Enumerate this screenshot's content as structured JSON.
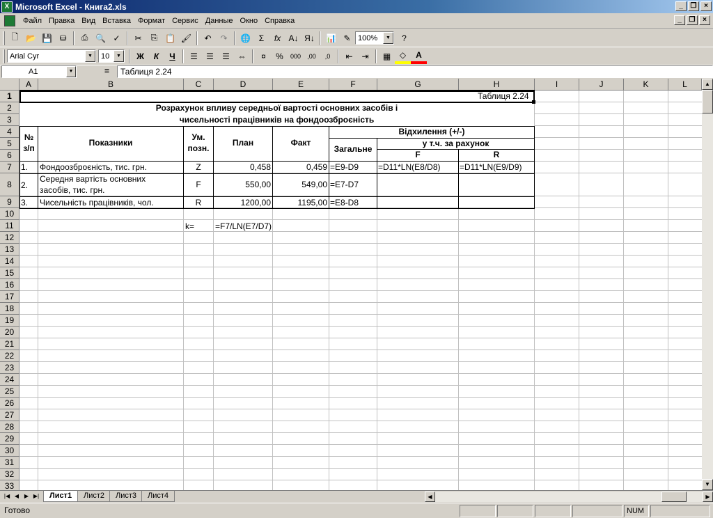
{
  "window": {
    "title": "Microsoft Excel - Книга2.xls",
    "app_icon_glyph": "X"
  },
  "menu": [
    "Файл",
    "Правка",
    "Вид",
    "Вставка",
    "Формат",
    "Сервис",
    "Данные",
    "Окно",
    "Справка"
  ],
  "toolbar": {
    "zoom": "100%",
    "font": "Arial Cyr",
    "font_size": "10",
    "bold_glyph": "Ж",
    "italic_glyph": "К",
    "underline_glyph": "Ч",
    "percent_glyph": "%",
    "thousands_glyph": "000",
    "inc_dec_glyph": ",00",
    "dec_dec_glyph": ",0",
    "sum_glyph": "Σ",
    "fx_glyph": "fx",
    "accent_fill": "#ffff00",
    "accent_font": "#ff0000"
  },
  "formula_bar": {
    "name_box": "A1",
    "eq": "=",
    "content": "Таблиця 2.24"
  },
  "columns": [
    "A",
    "B",
    "C",
    "D",
    "E",
    "F",
    "G",
    "H",
    "I",
    "J",
    "K",
    "L"
  ],
  "rows": [
    "1",
    "2",
    "3",
    "4",
    "5",
    "6",
    "7",
    "8",
    "9",
    "10",
    "11",
    "12",
    "13",
    "14",
    "15",
    "16",
    "17",
    "18",
    "19",
    "20",
    "21",
    "22",
    "23",
    "24",
    "25",
    "26",
    "27",
    "28",
    "29",
    "30",
    "31",
    "32",
    "33"
  ],
  "sheet": {
    "h1": "Таблиця 2.24",
    "title1": "Розрахунок впливу середньої вартості основних засобів і",
    "title2": "чисельності працівників на фондоозброєність",
    "hdr_num1": "№",
    "hdr_num2": "з/п",
    "hdr_indicators": "Показники",
    "hdr_sym1": "Ум.",
    "hdr_sym2": "позн.",
    "hdr_plan": "План",
    "hdr_fact": "Факт",
    "hdr_dev": "Відхилення (+/-)",
    "hdr_total": "Загальне",
    "hdr_incl": "у т.ч. за рахунок",
    "hdr_F": "F",
    "hdr_R": "R",
    "r7": [
      "1.",
      "Фондоозброєність, тис. грн.",
      "Z",
      "0,458",
      "0,459",
      "=E9-D9",
      "=D11*LN(E8/D8)",
      "=D11*LN(E9/D9)"
    ],
    "r8": [
      "2.",
      "Середня вартість основних",
      "засобів, тис. грн.",
      "F",
      "550,00",
      "549,00",
      "=E7-D7"
    ],
    "r9": [
      "3.",
      "Чисельність працівників, чол.",
      "R",
      "1200,00",
      "1195,00",
      "=E8-D8"
    ],
    "k_label": "k=",
    "k_formula": "=F7/LN(E7/D7)"
  },
  "tabs": [
    "Лист1",
    "Лист2",
    "Лист3",
    "Лист4"
  ],
  "status": {
    "ready": "Готово",
    "num": "NUM"
  }
}
